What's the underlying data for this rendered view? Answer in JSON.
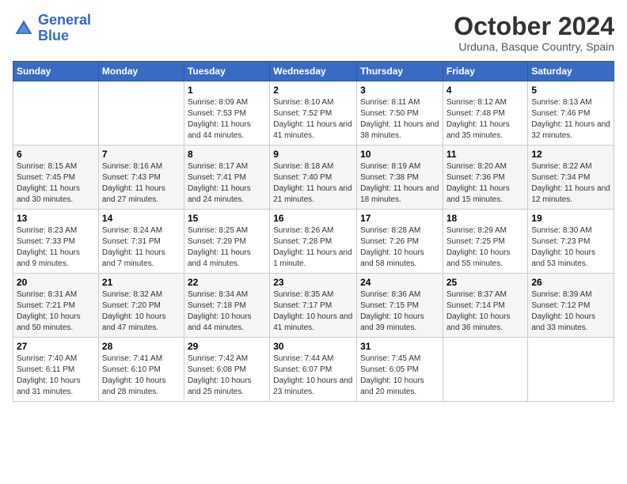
{
  "header": {
    "logo_general": "General",
    "logo_blue": "Blue",
    "month": "October 2024",
    "location": "Urduna, Basque Country, Spain"
  },
  "days_of_week": [
    "Sunday",
    "Monday",
    "Tuesday",
    "Wednesday",
    "Thursday",
    "Friday",
    "Saturday"
  ],
  "weeks": [
    [
      {
        "day": "",
        "sunrise": "",
        "sunset": "",
        "daylight": ""
      },
      {
        "day": "",
        "sunrise": "",
        "sunset": "",
        "daylight": ""
      },
      {
        "day": "1",
        "sunrise": "Sunrise: 8:09 AM",
        "sunset": "Sunset: 7:53 PM",
        "daylight": "Daylight: 11 hours and 44 minutes."
      },
      {
        "day": "2",
        "sunrise": "Sunrise: 8:10 AM",
        "sunset": "Sunset: 7:52 PM",
        "daylight": "Daylight: 11 hours and 41 minutes."
      },
      {
        "day": "3",
        "sunrise": "Sunrise: 8:11 AM",
        "sunset": "Sunset: 7:50 PM",
        "daylight": "Daylight: 11 hours and 38 minutes."
      },
      {
        "day": "4",
        "sunrise": "Sunrise: 8:12 AM",
        "sunset": "Sunset: 7:48 PM",
        "daylight": "Daylight: 11 hours and 35 minutes."
      },
      {
        "day": "5",
        "sunrise": "Sunrise: 8:13 AM",
        "sunset": "Sunset: 7:46 PM",
        "daylight": "Daylight: 11 hours and 32 minutes."
      }
    ],
    [
      {
        "day": "6",
        "sunrise": "Sunrise: 8:15 AM",
        "sunset": "Sunset: 7:45 PM",
        "daylight": "Daylight: 11 hours and 30 minutes."
      },
      {
        "day": "7",
        "sunrise": "Sunrise: 8:16 AM",
        "sunset": "Sunset: 7:43 PM",
        "daylight": "Daylight: 11 hours and 27 minutes."
      },
      {
        "day": "8",
        "sunrise": "Sunrise: 8:17 AM",
        "sunset": "Sunset: 7:41 PM",
        "daylight": "Daylight: 11 hours and 24 minutes."
      },
      {
        "day": "9",
        "sunrise": "Sunrise: 8:18 AM",
        "sunset": "Sunset: 7:40 PM",
        "daylight": "Daylight: 11 hours and 21 minutes."
      },
      {
        "day": "10",
        "sunrise": "Sunrise: 8:19 AM",
        "sunset": "Sunset: 7:38 PM",
        "daylight": "Daylight: 11 hours and 18 minutes."
      },
      {
        "day": "11",
        "sunrise": "Sunrise: 8:20 AM",
        "sunset": "Sunset: 7:36 PM",
        "daylight": "Daylight: 11 hours and 15 minutes."
      },
      {
        "day": "12",
        "sunrise": "Sunrise: 8:22 AM",
        "sunset": "Sunset: 7:34 PM",
        "daylight": "Daylight: 11 hours and 12 minutes."
      }
    ],
    [
      {
        "day": "13",
        "sunrise": "Sunrise: 8:23 AM",
        "sunset": "Sunset: 7:33 PM",
        "daylight": "Daylight: 11 hours and 9 minutes."
      },
      {
        "day": "14",
        "sunrise": "Sunrise: 8:24 AM",
        "sunset": "Sunset: 7:31 PM",
        "daylight": "Daylight: 11 hours and 7 minutes."
      },
      {
        "day": "15",
        "sunrise": "Sunrise: 8:25 AM",
        "sunset": "Sunset: 7:29 PM",
        "daylight": "Daylight: 11 hours and 4 minutes."
      },
      {
        "day": "16",
        "sunrise": "Sunrise: 8:26 AM",
        "sunset": "Sunset: 7:28 PM",
        "daylight": "Daylight: 11 hours and 1 minute."
      },
      {
        "day": "17",
        "sunrise": "Sunrise: 8:28 AM",
        "sunset": "Sunset: 7:26 PM",
        "daylight": "Daylight: 10 hours and 58 minutes."
      },
      {
        "day": "18",
        "sunrise": "Sunrise: 8:29 AM",
        "sunset": "Sunset: 7:25 PM",
        "daylight": "Daylight: 10 hours and 55 minutes."
      },
      {
        "day": "19",
        "sunrise": "Sunrise: 8:30 AM",
        "sunset": "Sunset: 7:23 PM",
        "daylight": "Daylight: 10 hours and 53 minutes."
      }
    ],
    [
      {
        "day": "20",
        "sunrise": "Sunrise: 8:31 AM",
        "sunset": "Sunset: 7:21 PM",
        "daylight": "Daylight: 10 hours and 50 minutes."
      },
      {
        "day": "21",
        "sunrise": "Sunrise: 8:32 AM",
        "sunset": "Sunset: 7:20 PM",
        "daylight": "Daylight: 10 hours and 47 minutes."
      },
      {
        "day": "22",
        "sunrise": "Sunrise: 8:34 AM",
        "sunset": "Sunset: 7:18 PM",
        "daylight": "Daylight: 10 hours and 44 minutes."
      },
      {
        "day": "23",
        "sunrise": "Sunrise: 8:35 AM",
        "sunset": "Sunset: 7:17 PM",
        "daylight": "Daylight: 10 hours and 41 minutes."
      },
      {
        "day": "24",
        "sunrise": "Sunrise: 8:36 AM",
        "sunset": "Sunset: 7:15 PM",
        "daylight": "Daylight: 10 hours and 39 minutes."
      },
      {
        "day": "25",
        "sunrise": "Sunrise: 8:37 AM",
        "sunset": "Sunset: 7:14 PM",
        "daylight": "Daylight: 10 hours and 36 minutes."
      },
      {
        "day": "26",
        "sunrise": "Sunrise: 8:39 AM",
        "sunset": "Sunset: 7:12 PM",
        "daylight": "Daylight: 10 hours and 33 minutes."
      }
    ],
    [
      {
        "day": "27",
        "sunrise": "Sunrise: 7:40 AM",
        "sunset": "Sunset: 6:11 PM",
        "daylight": "Daylight: 10 hours and 31 minutes."
      },
      {
        "day": "28",
        "sunrise": "Sunrise: 7:41 AM",
        "sunset": "Sunset: 6:10 PM",
        "daylight": "Daylight: 10 hours and 28 minutes."
      },
      {
        "day": "29",
        "sunrise": "Sunrise: 7:42 AM",
        "sunset": "Sunset: 6:08 PM",
        "daylight": "Daylight: 10 hours and 25 minutes."
      },
      {
        "day": "30",
        "sunrise": "Sunrise: 7:44 AM",
        "sunset": "Sunset: 6:07 PM",
        "daylight": "Daylight: 10 hours and 23 minutes."
      },
      {
        "day": "31",
        "sunrise": "Sunrise: 7:45 AM",
        "sunset": "Sunset: 6:05 PM",
        "daylight": "Daylight: 10 hours and 20 minutes."
      },
      {
        "day": "",
        "sunrise": "",
        "sunset": "",
        "daylight": ""
      },
      {
        "day": "",
        "sunrise": "",
        "sunset": "",
        "daylight": ""
      }
    ]
  ]
}
